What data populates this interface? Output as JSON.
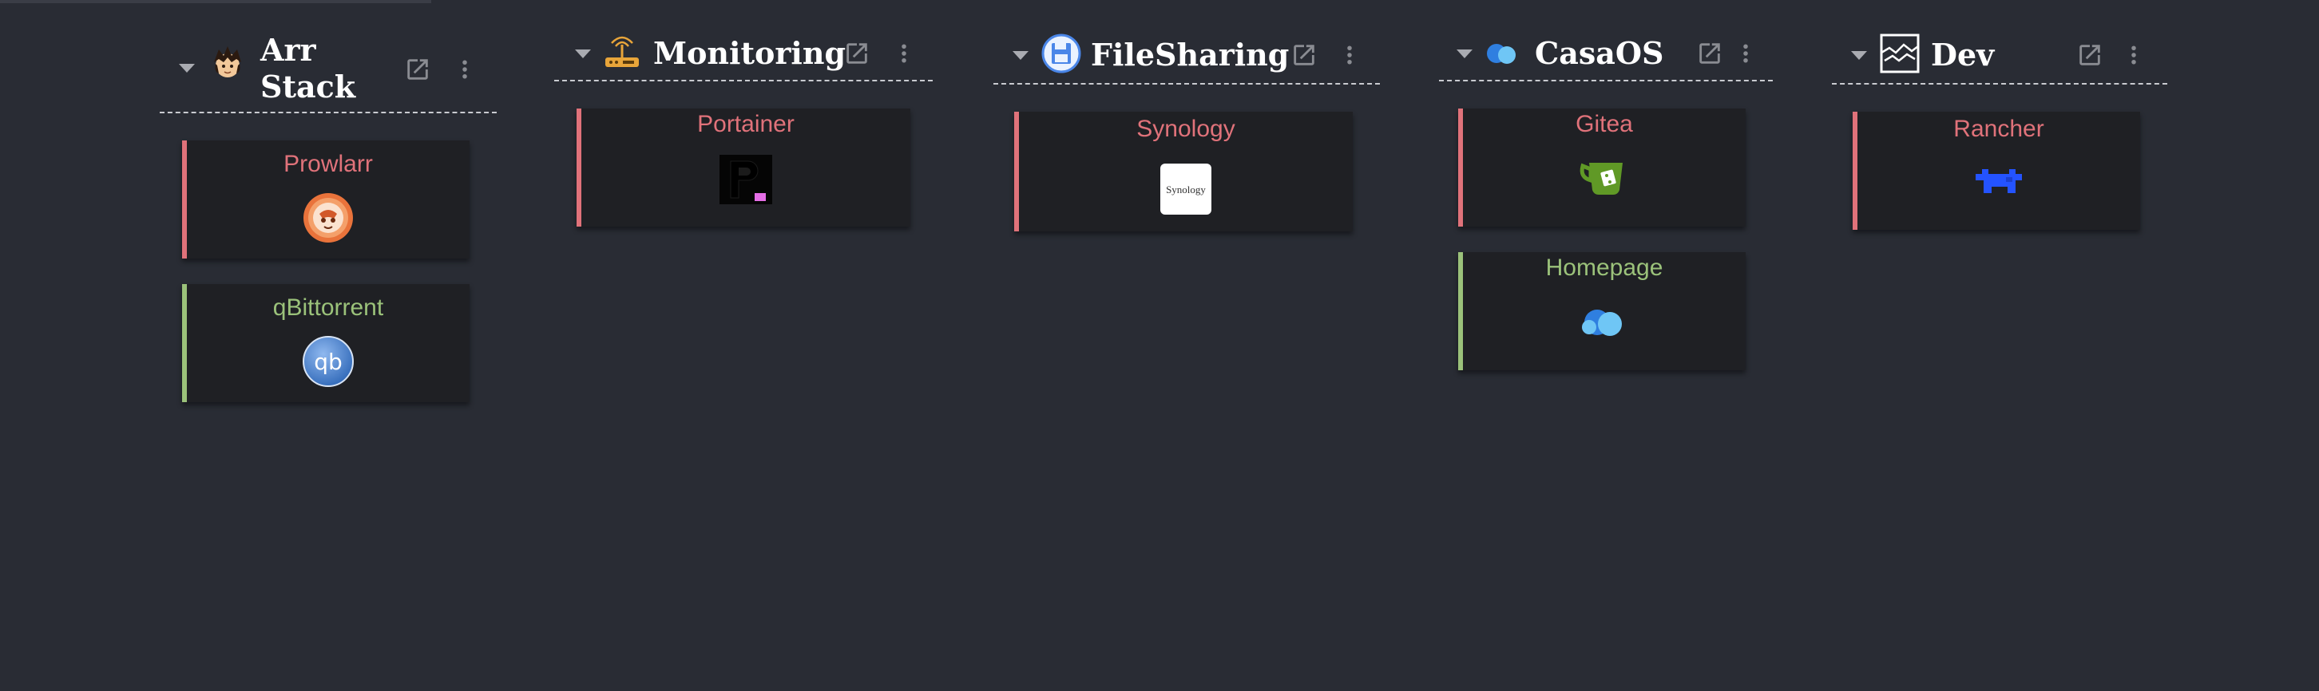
{
  "colors": {
    "background": "#292c34",
    "card_background": "#1f2024",
    "status_down": "#e0727a",
    "status_up": "#9bc27a",
    "title": "#ffffff",
    "muted_icon": "#a9abb1"
  },
  "sections": [
    {
      "title_line1": "Arr",
      "title_line2": "Stack",
      "icon": "anime-character-icon",
      "items": [
        {
          "label": "Prowlarr",
          "status": "down",
          "icon": "prowlarr-icon"
        },
        {
          "label": "qBittorrent",
          "status": "up",
          "icon": "qbittorrent-icon",
          "icon_text": "qb"
        }
      ]
    },
    {
      "title": "Monitoring",
      "icon": "router-icon",
      "items": [
        {
          "label": "Portainer",
          "status": "down",
          "icon": "portainer-icon"
        }
      ]
    },
    {
      "title": "FileSharing",
      "icon": "floppy-disk-icon",
      "items": [
        {
          "label": "Synology",
          "status": "down",
          "icon": "synology-icon",
          "icon_text": "Synology"
        }
      ]
    },
    {
      "title": "CasaOS",
      "icon": "casaos-icon",
      "items": [
        {
          "label": "Gitea",
          "status": "down",
          "icon": "gitea-icon"
        },
        {
          "label": "Homepage",
          "status": "up",
          "icon": "homepage-icon"
        }
      ]
    },
    {
      "title": "Dev",
      "icon": "dev-window-icon",
      "items": [
        {
          "label": "Rancher",
          "status": "down",
          "icon": "rancher-icon"
        }
      ]
    }
  ]
}
